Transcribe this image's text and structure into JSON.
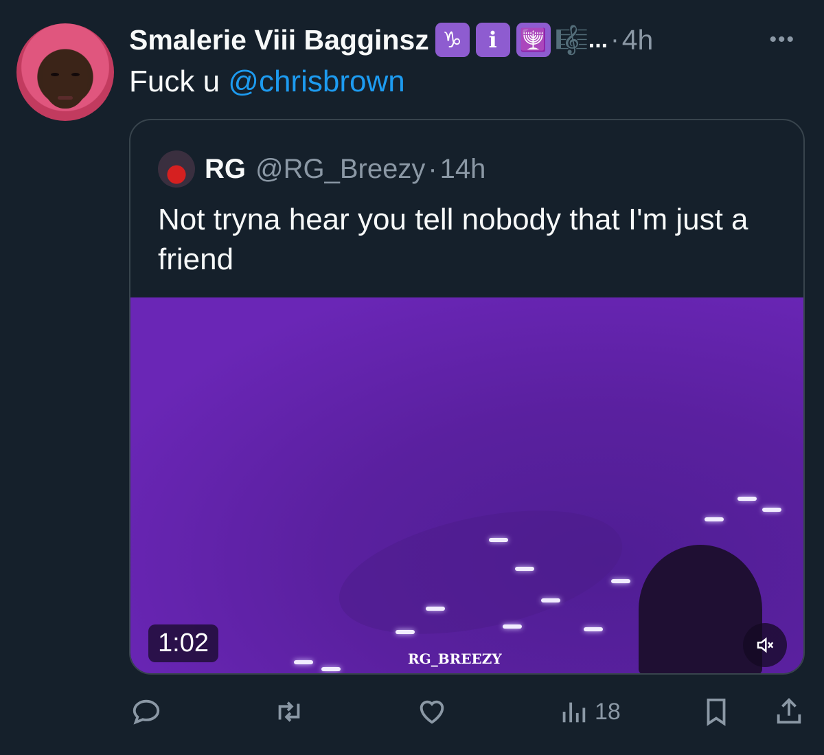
{
  "tweet": {
    "author_name": "Smalerie Viii Bagginsz",
    "name_emojis": [
      "♑",
      "ℹ",
      "🕎",
      "🎼"
    ],
    "name_truncation": "...",
    "separator": "·",
    "time": "4h",
    "text_prefix": "Fuck u ",
    "mention": "@chrisbrown",
    "more_label": "•••"
  },
  "quoted": {
    "name": "RG",
    "handle": "@RG_Breezy",
    "separator": "·",
    "time": "14h",
    "text": "Not tryna hear you tell nobody that I'm just a friend",
    "video": {
      "duration": "1:02",
      "watermark": "RG_BREEZY",
      "mute_icon": "speaker-muted-icon"
    }
  },
  "actions": {
    "reply_icon": "reply-icon",
    "retweet_icon": "retweet-icon",
    "like_icon": "heart-icon",
    "views_icon": "views-icon",
    "views_count": "18",
    "bookmark_icon": "bookmark-icon",
    "share_icon": "share-icon"
  },
  "colors": {
    "background": "#15202b",
    "mention": "#1d9bf0",
    "muted_text": "#8b98a5",
    "emoji_badge": "#8e5cd0",
    "video_purple": "#5a209f"
  }
}
